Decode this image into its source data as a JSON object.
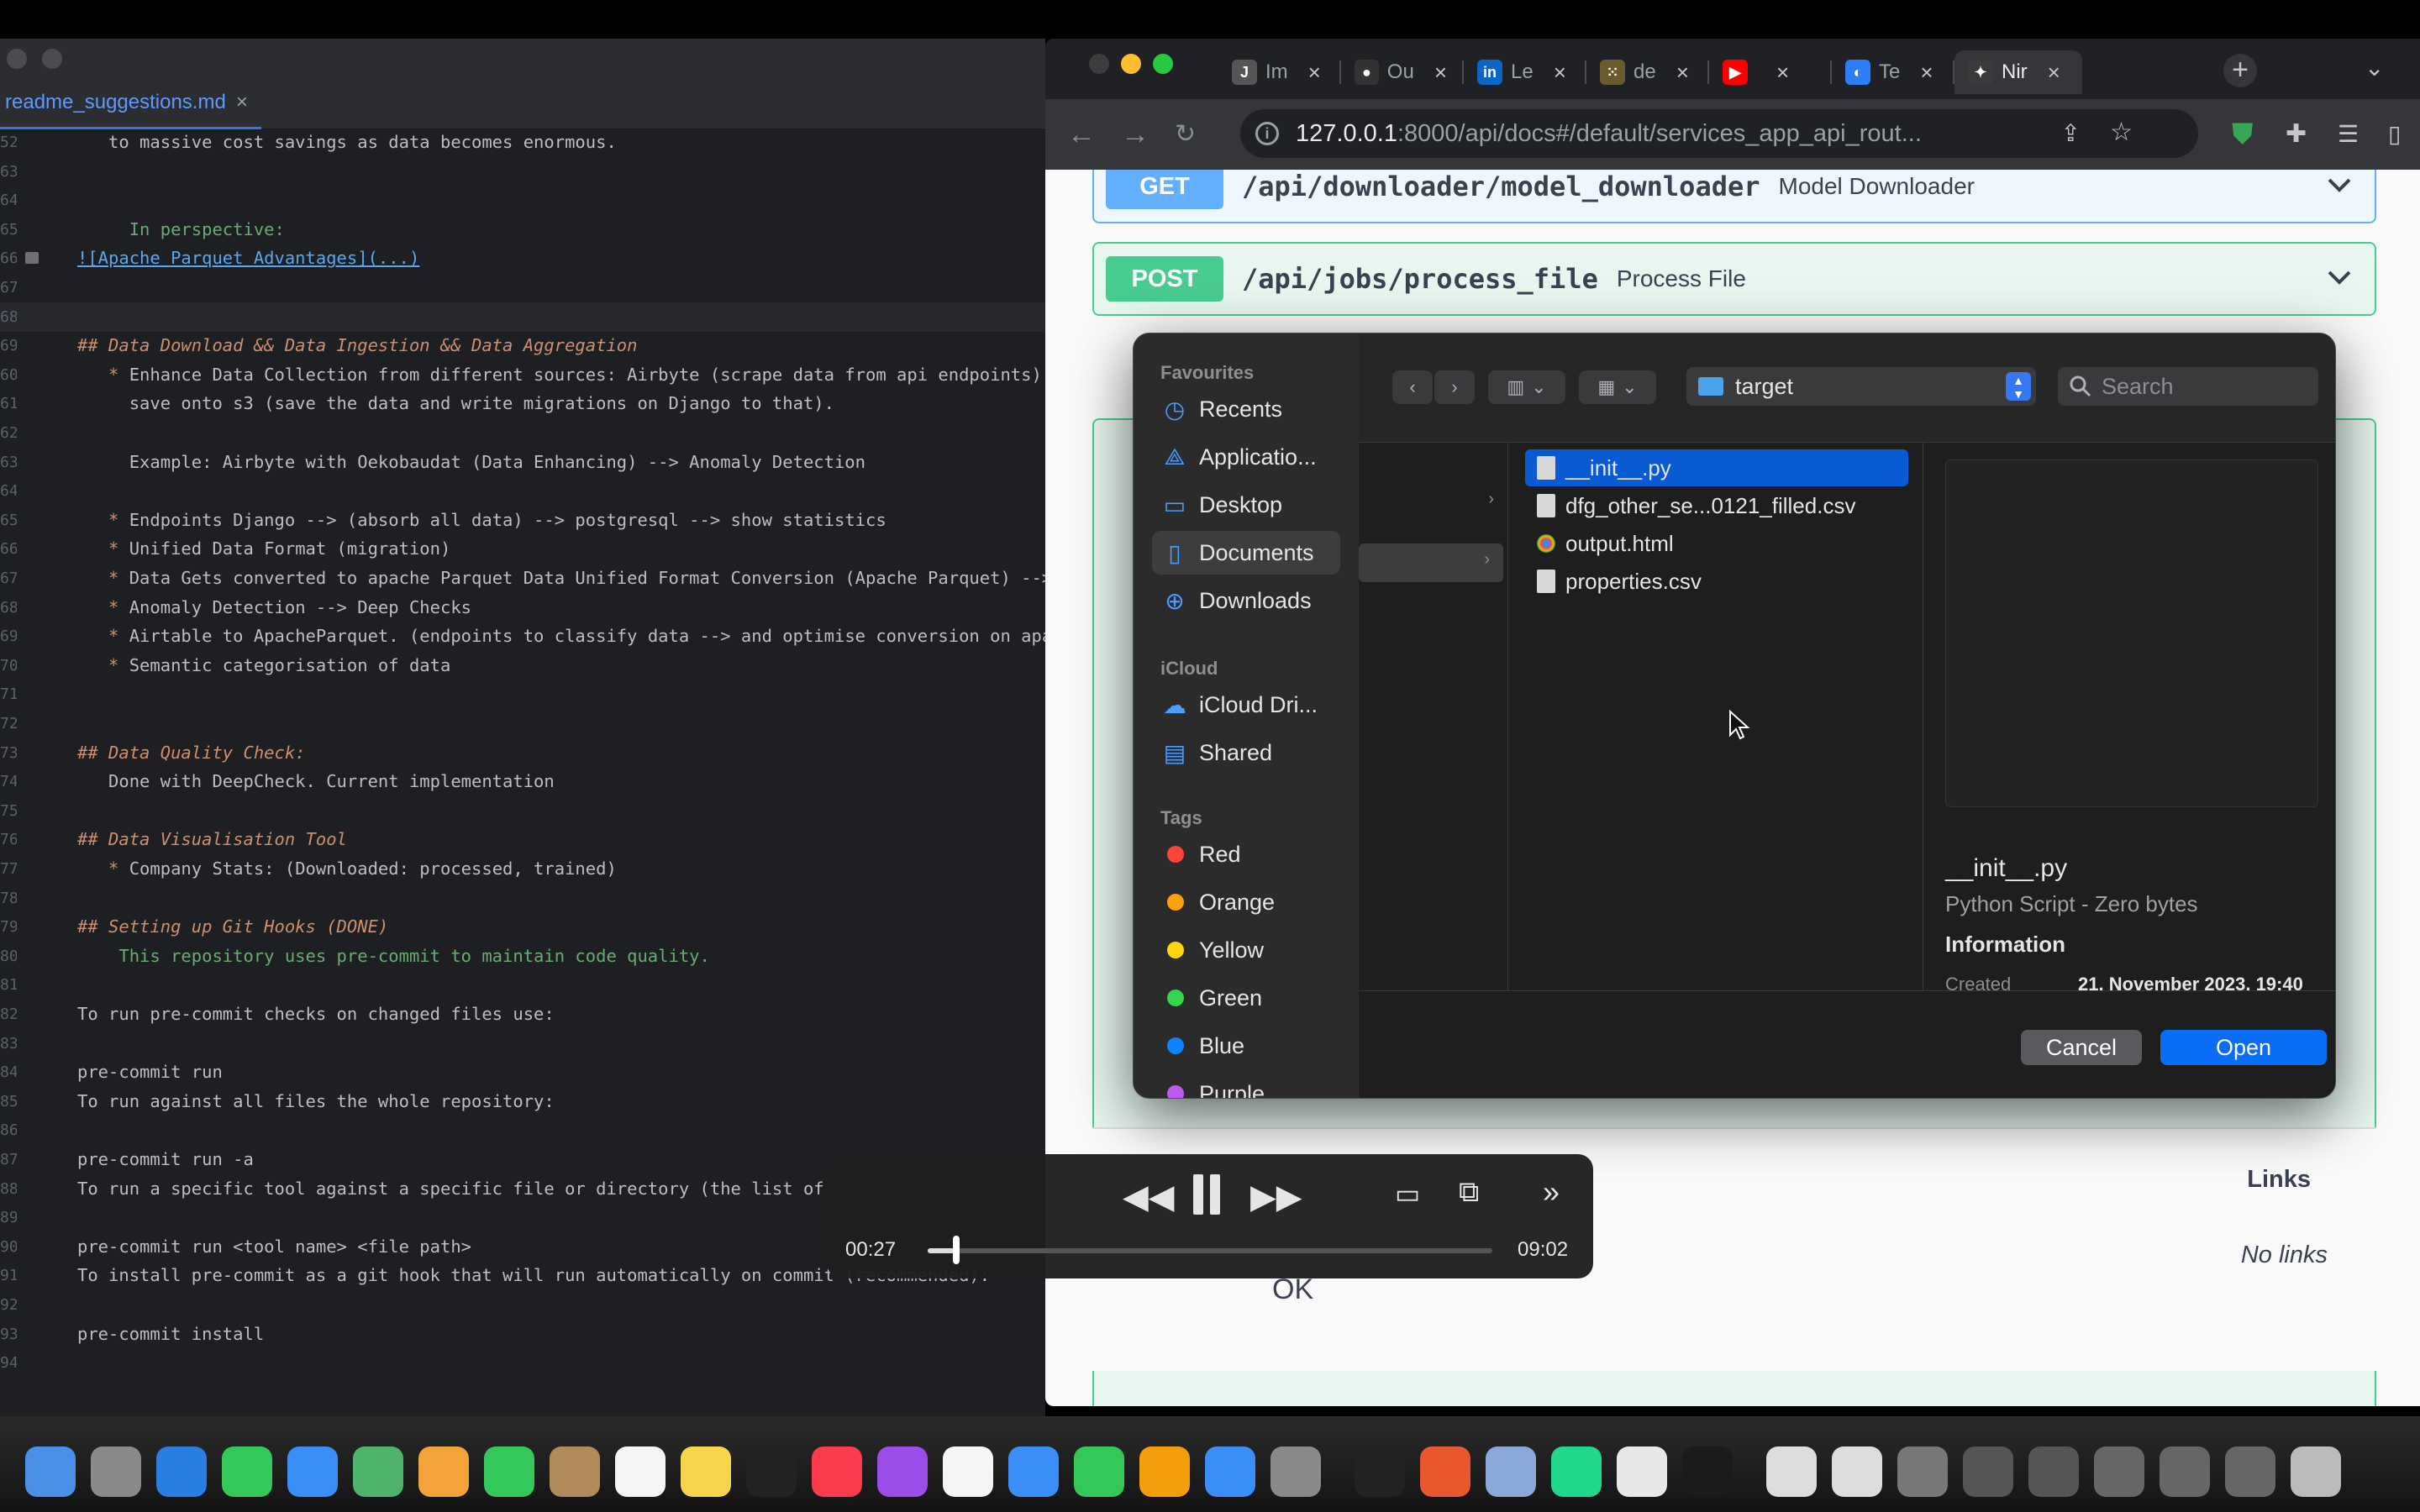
{
  "editor": {
    "tab_title": "readme_suggestions.md",
    "tab_close": "×",
    "lines": [
      {
        "ln": "52",
        "text": "   to massive cost savings as data becomes enormous."
      },
      {
        "ln": "63",
        "text": ""
      },
      {
        "ln": "64",
        "text": ""
      },
      {
        "ln": "65",
        "text": "     In perspective:",
        "style": "green"
      },
      {
        "ln": "66",
        "text": "![Apache Parquet Advantages](...)",
        "style": "link"
      },
      {
        "ln": "67",
        "text": ""
      },
      {
        "ln": "68",
        "text": ""
      },
      {
        "ln": "69",
        "text": "## Data Download && Data Ingestion && Data Aggregation",
        "style": "h2"
      },
      {
        "ln": "60",
        "text": "   * Enhance Data Collection from different sources: Airbyte (scrape data from api endpoints)",
        "style": "bullet"
      },
      {
        "ln": "61",
        "text": "     save onto s3 (save the data and write migrations on Django to that)."
      },
      {
        "ln": "62",
        "text": ""
      },
      {
        "ln": "63",
        "text": "     Example: Airbyte with Oekobaudat (Data Enhancing) --> Anomaly Detection"
      },
      {
        "ln": "64",
        "text": ""
      },
      {
        "ln": "65",
        "text": "   * Endpoints Django --> (absorb all data) --> postgresql --> show statistics",
        "style": "bullet"
      },
      {
        "ln": "66",
        "text": "   * Unified Data Format (migration)",
        "style": "bullet"
      },
      {
        "ln": "67",
        "text": "   * Data Gets converted to apache Parquet Data Unified Format Conversion (Apache Parquet) -->",
        "style": "bullet"
      },
      {
        "ln": "68",
        "text": "   * Anomaly Detection --> Deep Checks",
        "style": "bullet"
      },
      {
        "ln": "69",
        "text": "   * Airtable to ApacheParquet. (endpoints to classify data --> and optimise conversion on apa",
        "style": "bullet"
      },
      {
        "ln": "70",
        "text": "   * Semantic categorisation of data",
        "style": "bullet"
      },
      {
        "ln": "71",
        "text": ""
      },
      {
        "ln": "72",
        "text": ""
      },
      {
        "ln": "73",
        "text": "## Data Quality Check:",
        "style": "h2"
      },
      {
        "ln": "74",
        "text": "   Done with DeepCheck. Current implementation"
      },
      {
        "ln": "75",
        "text": ""
      },
      {
        "ln": "76",
        "text": "## Data Visualisation Tool",
        "style": "h2"
      },
      {
        "ln": "77",
        "text": "   * Company Stats: (Downloaded: processed, trained)",
        "style": "bullet"
      },
      {
        "ln": "78",
        "text": ""
      },
      {
        "ln": "79",
        "text": "## Setting up Git Hooks (DONE)",
        "style": "h2"
      },
      {
        "ln": "80",
        "text": "    This repository uses pre-commit to maintain code quality.",
        "style": "green"
      },
      {
        "ln": "81",
        "text": ""
      },
      {
        "ln": "82",
        "text": "To run pre-commit checks on changed files use:"
      },
      {
        "ln": "83",
        "text": ""
      },
      {
        "ln": "84",
        "text": "pre-commit run"
      },
      {
        "ln": "85",
        "text": "To run against all files the whole repository:"
      },
      {
        "ln": "86",
        "text": ""
      },
      {
        "ln": "87",
        "text": "pre-commit run -a"
      },
      {
        "ln": "88",
        "text": "To run a specific tool against a specific file or directory (the list of"
      },
      {
        "ln": "89",
        "text": ""
      },
      {
        "ln": "90",
        "text": "pre-commit run <tool name> <file path>"
      },
      {
        "ln": "91",
        "text": "To install pre-commit as a git hook that will run automatically on commit (recommended):"
      },
      {
        "ln": "92",
        "text": ""
      },
      {
        "ln": "93",
        "text": "pre-commit install"
      },
      {
        "ln": "94",
        "text": ""
      }
    ]
  },
  "browser": {
    "tabs": [
      {
        "label": "Im",
        "icon": "jetbrains-icon",
        "color": "#555555",
        "glyph": "J"
      },
      {
        "label": "Ou",
        "icon": "github-icon",
        "color": "#333333",
        "glyph": "●"
      },
      {
        "label": "Le",
        "icon": "linkedin-icon",
        "color": "#0a66c2",
        "glyph": "in"
      },
      {
        "label": "de",
        "icon": "grid-icon",
        "color": "#6b5a2b",
        "glyph": "⁙"
      },
      {
        "label": "",
        "icon": "youtube-icon",
        "color": "#ff0000",
        "glyph": "▶"
      },
      {
        "label": "Te",
        "icon": "telegram-icon",
        "color": "#2f7df6",
        "glyph": "◐"
      },
      {
        "label": "Nir",
        "icon": "pin-icon",
        "color": "#3a3a3a",
        "glyph": "✦"
      }
    ],
    "url_host": "127.0.0.1",
    "url_rest": ":8000/api/docs#/default/services_app_api_rout...",
    "ops": [
      {
        "method": "GET",
        "path": "/api/downloader/model_downloader",
        "summary": "Model Downloader"
      },
      {
        "method": "POST",
        "path": "/api/jobs/process_file",
        "summary": "Process File"
      }
    ],
    "links_header": "Links",
    "no_links": "No links",
    "ok_text": "OK"
  },
  "dialog": {
    "sections": {
      "favourites": "Favourites",
      "icloud": "iCloud",
      "tags": "Tags"
    },
    "favourites": [
      {
        "label": "Recents",
        "icon": "clock-icon",
        "glyph": "◷"
      },
      {
        "label": "Applicatio...",
        "icon": "applications-icon",
        "glyph": "⟁"
      },
      {
        "label": "Desktop",
        "icon": "desktop-icon",
        "glyph": "▭"
      },
      {
        "label": "Documents",
        "icon": "document-icon",
        "glyph": "▯"
      },
      {
        "label": "Downloads",
        "icon": "download-icon",
        "glyph": "⊕"
      }
    ],
    "icloud": [
      {
        "label": "iCloud Dri...",
        "icon": "cloud-icon",
        "glyph": "☁"
      },
      {
        "label": "Shared",
        "icon": "shared-folder-icon",
        "glyph": "▤"
      }
    ],
    "tags": [
      {
        "label": "Red",
        "color": "#ff453a"
      },
      {
        "label": "Orange",
        "color": "#ff9f0a"
      },
      {
        "label": "Yellow",
        "color": "#ffd60a"
      },
      {
        "label": "Green",
        "color": "#32d74b"
      },
      {
        "label": "Blue",
        "color": "#0a84ff"
      },
      {
        "label": "Purple",
        "color": "#bf5af2"
      }
    ],
    "current_folder": "target",
    "search_placeholder": "Search",
    "files": [
      {
        "name": "__init__.py",
        "type": "doc"
      },
      {
        "name": "dfg_other_se...0121_filled.csv",
        "type": "doc"
      },
      {
        "name": "output.html",
        "type": "chrome"
      },
      {
        "name": "properties.csv",
        "type": "doc"
      }
    ],
    "preview": {
      "name": "__init__.py",
      "kind": "Python Script - Zero bytes",
      "info_label": "Information",
      "created_label": "Created",
      "created_value": "21. November 2023, 19:40"
    },
    "cancel": "Cancel",
    "open": "Open"
  },
  "player": {
    "elapsed": "00:27",
    "total": "09:02",
    "progress": 0.05
  }
}
